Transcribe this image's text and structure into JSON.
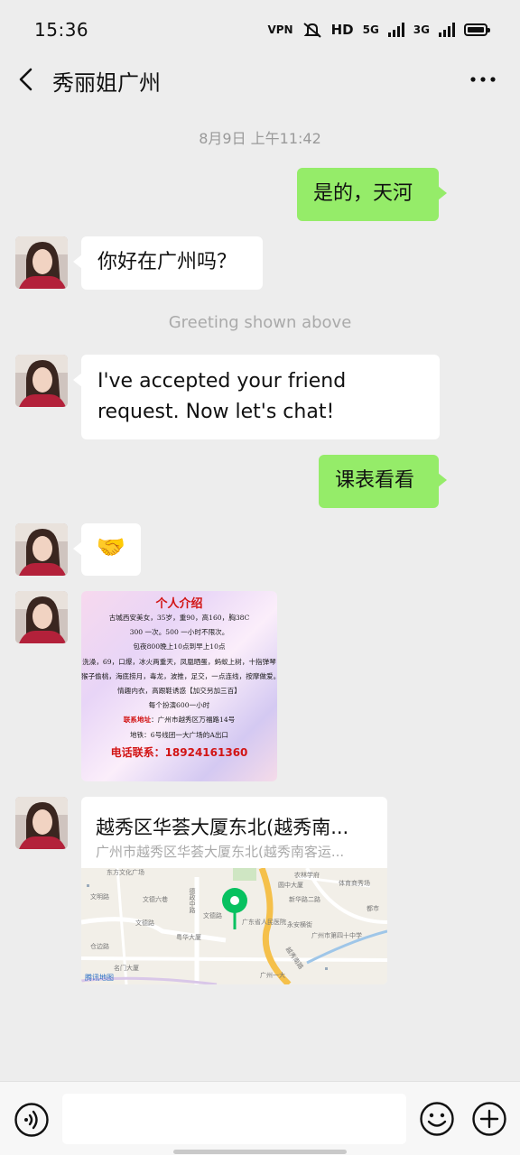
{
  "status_bar": {
    "time": "15:36",
    "vpn": "VPN",
    "hd": "HD",
    "network_1": "5G",
    "network_2": "3G"
  },
  "header": {
    "title": "秀丽姐广州"
  },
  "messages": {
    "timestamp": "8月9日 上午11:42",
    "out_1": "是的，天河",
    "in_1": "你好在广州吗？",
    "system_note": "Greeting shown above",
    "in_2": "I've accepted your friend request. Now let's chat!",
    "out_2": "课表看看",
    "in_3_emoji": "🤝"
  },
  "poster": {
    "title": "个人介绍",
    "lines": [
      "古城西安美女，35岁，重90，高160，胸38C",
      "300 一次。500 一小时不限次。",
      "包夜800晚上10点到早上10点",
      "洗澡，69，口爆，冰火两重天，凤凰晒蛋，蚂蚁上树，十指弹琴",
      "猴子偷桃，海底捞月，毒龙，波推，足交，一点连线，按摩做爱。",
      "情趣内衣，高跟鞋诱惑【加交另加三百】",
      "每个扮演600一小时"
    ],
    "address_label": "联系地址",
    "address": "：广州市越秀区万福路14号",
    "metro": "地铁：6号线团一大广场的A出口",
    "phone": "电话联系：18924161360"
  },
  "location": {
    "title": "越秀区华荟大厦东北(越秀南...",
    "address": "广州市越秀区华荟大厦东北(越秀南客运...",
    "map_provider": "腾讯地图",
    "map_labels": [
      "东方文化广场",
      "农林学府",
      "文明路",
      "文德六巷",
      "德政中路",
      "圆中大厦",
      "体育商秀场",
      "文德路",
      "粤华大厦",
      "新华路二路",
      "仓边路",
      "广东省人民医院",
      "广州市第四十中学",
      "越秀南路",
      "永安横街",
      "文德路",
      "名门大厦",
      "广州一大",
      "都市"
    ],
    "pin_color": "#07c160"
  },
  "input_bar": {
    "placeholder": ""
  },
  "colors": {
    "background": "#ededed",
    "bubble_out": "#95ec69",
    "bubble_in": "#ffffff"
  }
}
